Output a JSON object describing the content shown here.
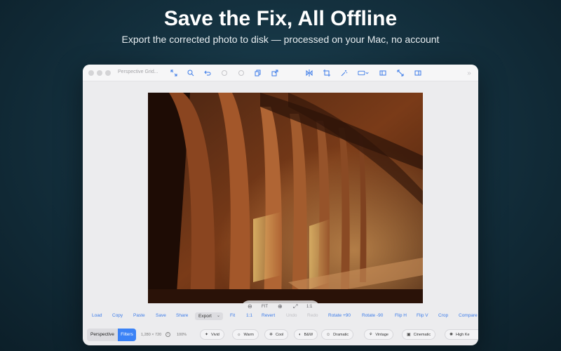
{
  "hero": {
    "title": "Save the Fix, All Offline",
    "subtitle": "Export the corrected photo to disk — processed on your Mac, no account"
  },
  "window": {
    "title": "Perspective Grid...",
    "toolbar_icons": [
      "fit-screen-icon",
      "zoom-in-icon",
      "undo-icon",
      "disabled-icon",
      "disabled-icon",
      "copy-icon",
      "export-icon",
      "flip-icon",
      "crop-icon",
      "magic-wand-icon",
      "aspect-select-icon",
      "sidebar-icon",
      "expand-icon",
      "panel-icon"
    ]
  },
  "zoom_controls": {
    "zoom_out": "⊖",
    "fit": "FIT",
    "zoom_in": "⊕",
    "expand": "⤢",
    "one_to_one": "1:1"
  },
  "actions": {
    "load": "Load",
    "copy": "Copy",
    "paste": "Paste",
    "save": "Save",
    "share": "Share",
    "export": "Export",
    "fit": "Fit",
    "one_to_one": "1:1",
    "revert": "Revert",
    "undo": "Undo",
    "redo": "Redo",
    "rotate_plus": "Rotate +90",
    "rotate_minus": "Rotate -90",
    "flip_h": "Flip H",
    "flip_v": "Flip V",
    "crop": "Crop",
    "compare": "Compare"
  },
  "bottom": {
    "tab_perspective": "Perspective",
    "tab_filters": "Filters",
    "dimensions": "1,280 × 720",
    "zoom_percent": "100%",
    "filters": [
      {
        "label": "Vivid",
        "icon": "sparkle-icon"
      },
      {
        "label": "Warm",
        "icon": "sun-icon"
      },
      {
        "label": "Cool",
        "icon": "snowflake-icon"
      },
      {
        "label": "B&W",
        "icon": "contrast-icon"
      },
      {
        "label": "Dramatic",
        "icon": "masks-icon"
      },
      {
        "label": "Vintage",
        "icon": "vintage-icon"
      },
      {
        "label": "Cinematic",
        "icon": "film-icon"
      },
      {
        "label": "High Ke",
        "icon": "sun-bright-icon"
      }
    ]
  },
  "colors": {
    "accent": "#3b7be8",
    "selected_tab": "#3b82f6"
  }
}
